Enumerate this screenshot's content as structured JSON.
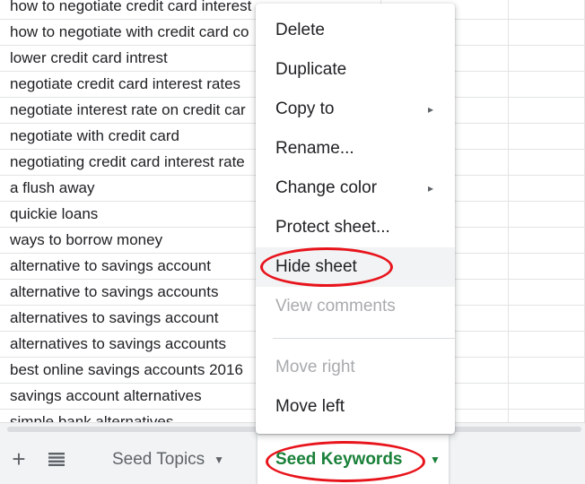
{
  "grid": {
    "rows": [
      "how to negotiate credit card interest",
      "how to negotiate with credit card co",
      "lower credit card intrest",
      "negotiate credit card interest rates",
      "negotiate interest rate on credit car",
      "negotiate with credit card",
      "negotiating credit card interest rate",
      "a flush away",
      "quickie loans",
      "ways to borrow money",
      "alternative to savings account",
      "alternative to savings accounts",
      "alternatives to savings account",
      "alternatives to savings accounts",
      "best online savings accounts 2016",
      "savings account alternatives",
      "simple bank alternatives"
    ]
  },
  "context_menu": {
    "items": [
      {
        "label": "Delete",
        "submenu": false,
        "disabled": false
      },
      {
        "label": "Duplicate",
        "submenu": false,
        "disabled": false
      },
      {
        "label": "Copy to",
        "submenu": true,
        "disabled": false
      },
      {
        "label": "Rename...",
        "submenu": false,
        "disabled": false
      },
      {
        "label": "Change color",
        "submenu": true,
        "disabled": false
      },
      {
        "label": "Protect sheet...",
        "submenu": false,
        "disabled": false
      },
      {
        "label": "Hide sheet",
        "submenu": false,
        "disabled": false,
        "highlighted": true
      },
      {
        "label": "View comments",
        "submenu": false,
        "disabled": true
      },
      {
        "label": "Move right",
        "submenu": false,
        "disabled": true
      },
      {
        "label": "Move left",
        "submenu": false,
        "disabled": false
      }
    ],
    "submenu_arrow": "▸"
  },
  "tabbar": {
    "add_icon": "+",
    "tabs": [
      {
        "label": "Seed Topics",
        "active": false
      },
      {
        "label": "Seed Keywords",
        "active": true
      }
    ],
    "dropdown_arrow": "▼"
  },
  "colors": {
    "accent_green": "#188038",
    "annotation_red": "#e8141c",
    "menu_hover": "#f1f3f4",
    "disabled_text": "#a8aaad"
  }
}
